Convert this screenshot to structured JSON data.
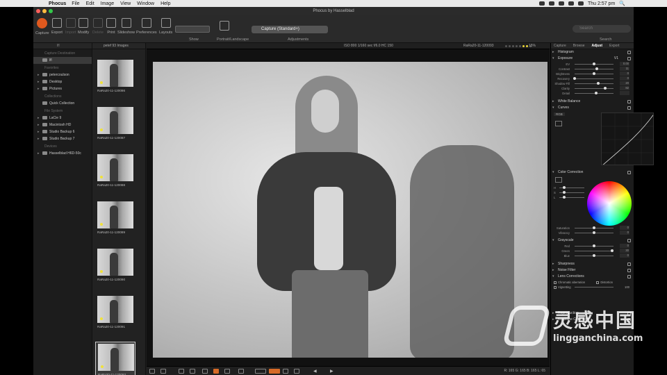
{
  "menubar": {
    "app_name": "Phocus",
    "items": [
      "File",
      "Edit",
      "Image",
      "View",
      "Window",
      "Help"
    ],
    "clock": "Thu 2:57 pm"
  },
  "window": {
    "title": "Phocus by Hasselblad"
  },
  "toolbar": {
    "tools": [
      {
        "label": "Capture",
        "icon": "capture-icon"
      },
      {
        "label": "Export",
        "icon": "export-icon"
      },
      {
        "label": "Import",
        "icon": "import-icon"
      },
      {
        "label": "Modify",
        "icon": "modify-icon"
      },
      {
        "label": "Delete",
        "icon": "delete-icon"
      },
      {
        "label": "Print",
        "icon": "print-icon"
      },
      {
        "label": "Slideshow",
        "icon": "slideshow-icon"
      },
      {
        "label": "Preferences",
        "icon": "preferences-icon"
      },
      {
        "label": "Layouts",
        "icon": "layouts-icon"
      }
    ],
    "show_label": "Show",
    "orientation_label": "Portrait/Landscape",
    "style_value": "Capture (Standard+)",
    "adjustments_label": "Adjustments",
    "search_placeholder": "Search",
    "search_label": "Search",
    "accent": "#e0591e"
  },
  "library": {
    "nav_value": "lfl",
    "capture_destination_label": "Capture Destination",
    "current_folder": "lfl",
    "favorites_label": "Favorites",
    "favorites": [
      "petercoulson",
      "Desktop",
      "Pictures"
    ],
    "collections_label": "Collections",
    "collections": [
      "Quick Collection"
    ],
    "file_system_label": "File System",
    "file_system": [
      "LaCie 9",
      "Macintosh HD",
      "Studio Backup 6",
      "Studio Backup 7"
    ],
    "devices_label": "Devices",
    "devices": [
      "Hasselblad H6D-50c"
    ]
  },
  "thumbnails": {
    "header": "petef 93 Images",
    "items": [
      {
        "name": "RaRa20-11-120086"
      },
      {
        "name": "RaRa20-11-120087"
      },
      {
        "name": "RaRa20-11-120088"
      },
      {
        "name": "RaRa20-11-120089"
      },
      {
        "name": "RaRa20-11-120090"
      },
      {
        "name": "RaRa20-11-120091"
      },
      {
        "name": "RaRa20-11-120093"
      }
    ]
  },
  "viewer": {
    "meta": "ISO 800  1/160 sec  f/6.0  HC 150",
    "filename": "RaRa20-11-120093",
    "zoom": "15%",
    "readout": "R: 165  G: 165  B: 165  L: 65"
  },
  "tools": {
    "tabs": [
      "Capture",
      "Browse",
      "Adjust",
      "Export"
    ],
    "active_tab": "Adjust",
    "histogram_label": "Histogram",
    "exposure": {
      "label": "Exposure",
      "preset": "V1",
      "sliders": [
        {
          "label": "EV",
          "value": "0.00",
          "pos": 0.5
        },
        {
          "label": "Contrast",
          "value": "11",
          "pos": 0.58
        },
        {
          "label": "Brightness",
          "value": "0",
          "pos": 0.5
        },
        {
          "label": "Recovery",
          "value": "0",
          "pos": 0.0
        },
        {
          "label": "Shadow Fill",
          "value": "20",
          "pos": 0.6
        },
        {
          "label": "Clarity",
          "value": "82",
          "pos": 0.78
        },
        {
          "label": "Detail",
          "value": "",
          "pos": 0.55
        }
      ]
    },
    "white_balance_label": "White Balance",
    "curves": {
      "label": "Curves",
      "channel": "RGB"
    },
    "color_correction": {
      "label": "Color Correction",
      "sliders": [
        {
          "label": "H",
          "value": "",
          "pos": 0.2
        },
        {
          "label": "S",
          "value": "",
          "pos": 0.2
        },
        {
          "label": "L",
          "value": "",
          "pos": 0.2
        },
        {
          "label": "Saturation",
          "value": "0",
          "pos": 0.5
        },
        {
          "label": "Vibrancy",
          "value": "0",
          "pos": 0.5
        }
      ]
    },
    "grayscale": {
      "label": "Grayscale",
      "sliders": [
        {
          "label": "Red",
          "value": "0",
          "pos": 0.5
        },
        {
          "label": "Green",
          "value": "30",
          "pos": 0.96
        },
        {
          "label": "Blue",
          "value": "0",
          "pos": 0.5
        }
      ]
    },
    "sharpness_label": "Sharpness",
    "noise_filter_label": "Noise Filter",
    "lens_corrections": {
      "label": "Lens Corrections",
      "chromatic_aberration": "Chromatic aberration",
      "distortion": "Distortion",
      "vignetting": "Vignetting",
      "vignetting_value": "100"
    },
    "reproduction_label": "Reproduction",
    "keystone_label": "Keystone Correction"
  },
  "watermark": {
    "text": "灵感中国",
    "url": "lingganchina.com"
  }
}
